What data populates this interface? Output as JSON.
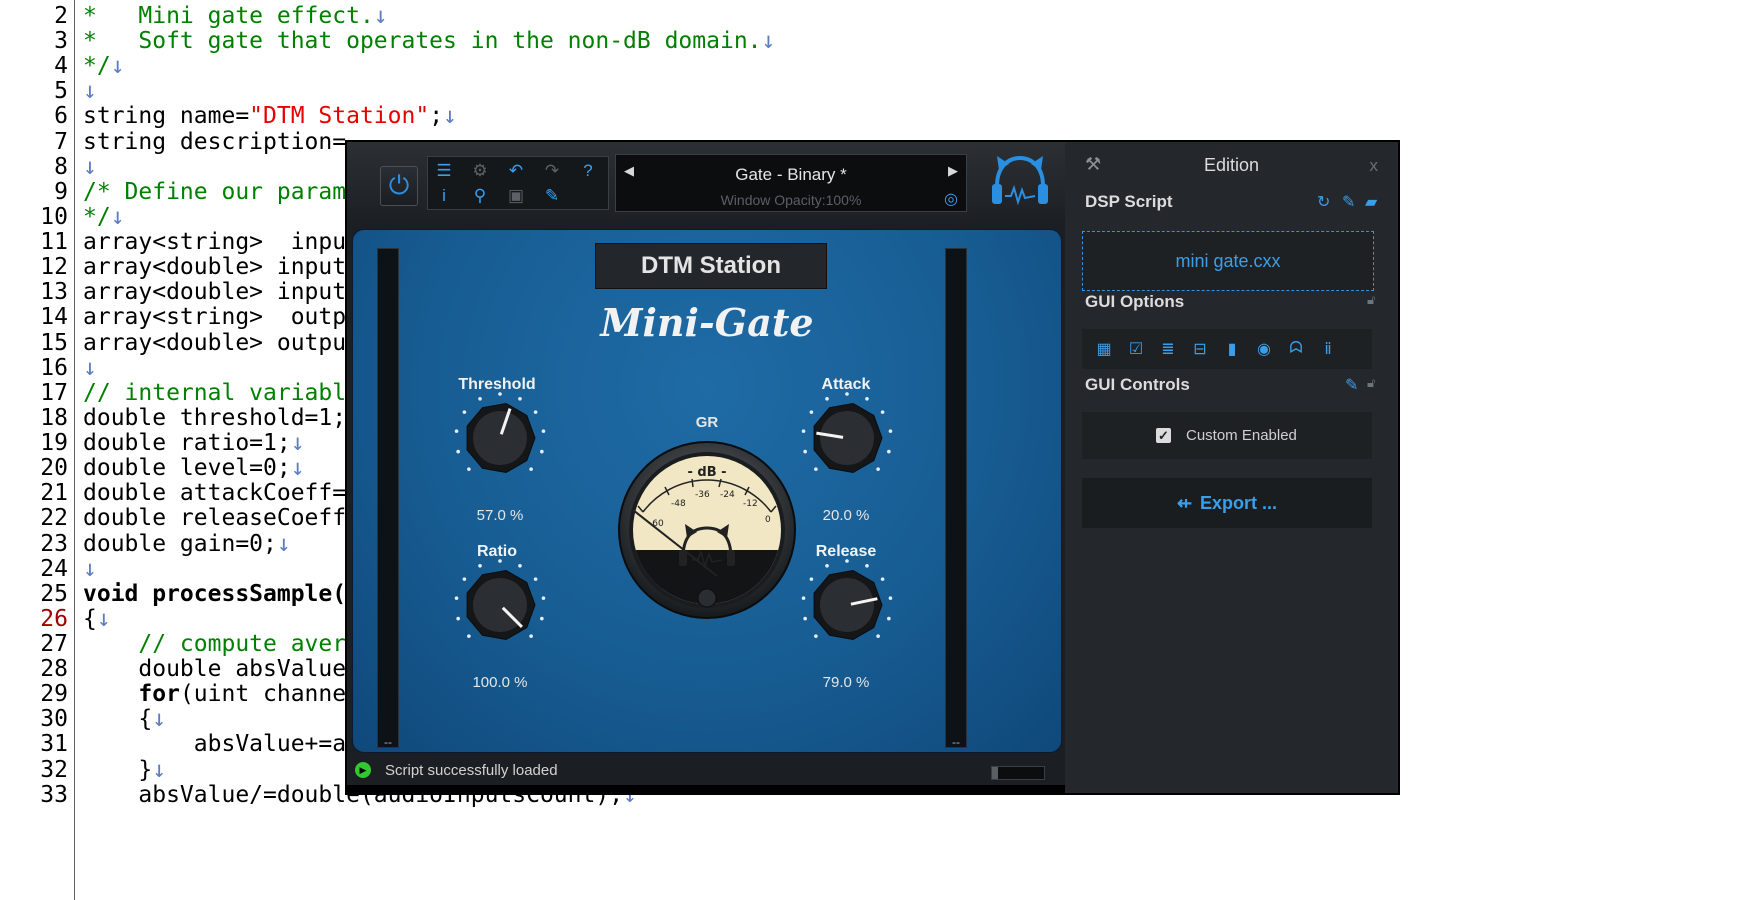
{
  "editor": {
    "current_line": "26",
    "lines": [
      {
        "num": "2",
        "parts": [
          {
            "t": "*   Mini gate effect.",
            "c": "cm"
          },
          {
            "t": "↓",
            "c": "ar"
          }
        ]
      },
      {
        "num": "3",
        "parts": [
          {
            "t": "*   Soft gate that operates in the non-dB domain.",
            "c": "cm"
          },
          {
            "t": "↓",
            "c": "ar"
          }
        ]
      },
      {
        "num": "4",
        "parts": [
          {
            "t": "*/",
            "c": "cm"
          },
          {
            "t": "↓",
            "c": "ar"
          }
        ]
      },
      {
        "num": "5",
        "parts": [
          {
            "t": "↓",
            "c": "ar"
          }
        ]
      },
      {
        "num": "6",
        "parts": [
          {
            "t": "string name=",
            "c": ""
          },
          {
            "t": "\"DTM Station\"",
            "c": "st"
          },
          {
            "t": ";",
            "c": ""
          },
          {
            "t": "↓",
            "c": "ar"
          }
        ]
      },
      {
        "num": "7",
        "parts": [
          {
            "t": "string description=",
            "c": ""
          }
        ]
      },
      {
        "num": "8",
        "parts": [
          {
            "t": "↓",
            "c": "ar"
          }
        ]
      },
      {
        "num": "9",
        "parts": [
          {
            "t": "/* Define our param",
            "c": "cm"
          }
        ]
      },
      {
        "num": "10",
        "parts": [
          {
            "t": "*/",
            "c": "cm"
          },
          {
            "t": "↓",
            "c": "ar"
          }
        ]
      },
      {
        "num": "11",
        "parts": [
          {
            "t": "array<string>  inpu",
            "c": ""
          }
        ]
      },
      {
        "num": "12",
        "parts": [
          {
            "t": "array<double> input",
            "c": ""
          }
        ]
      },
      {
        "num": "13",
        "parts": [
          {
            "t": "array<double> input",
            "c": ""
          }
        ]
      },
      {
        "num": "14",
        "parts": [
          {
            "t": "array<string>  outp",
            "c": ""
          }
        ]
      },
      {
        "num": "15",
        "parts": [
          {
            "t": "array<double> outpu",
            "c": ""
          }
        ]
      },
      {
        "num": "16",
        "parts": [
          {
            "t": "↓",
            "c": "ar"
          }
        ]
      },
      {
        "num": "17",
        "parts": [
          {
            "t": "// internal variabl",
            "c": "cm"
          }
        ]
      },
      {
        "num": "18",
        "parts": [
          {
            "t": "double threshold=1;",
            "c": ""
          }
        ]
      },
      {
        "num": "19",
        "parts": [
          {
            "t": "double ratio=1;",
            "c": ""
          },
          {
            "t": "↓",
            "c": "ar"
          }
        ]
      },
      {
        "num": "20",
        "parts": [
          {
            "t": "double level=0;",
            "c": ""
          },
          {
            "t": "↓",
            "c": "ar"
          }
        ]
      },
      {
        "num": "21",
        "parts": [
          {
            "t": "double attackCoeff=",
            "c": ""
          }
        ]
      },
      {
        "num": "22",
        "parts": [
          {
            "t": "double releaseCoeff",
            "c": ""
          }
        ]
      },
      {
        "num": "23",
        "parts": [
          {
            "t": "double gain=0;",
            "c": ""
          },
          {
            "t": "↓",
            "c": "ar"
          }
        ]
      },
      {
        "num": "24",
        "parts": [
          {
            "t": "↓",
            "c": "ar"
          }
        ]
      },
      {
        "num": "25",
        "parts": [
          {
            "t": "void processSample(",
            "c": "kw"
          }
        ]
      },
      {
        "num": "26",
        "parts": [
          {
            "t": "{",
            "c": ""
          },
          {
            "t": "↓",
            "c": "ar"
          }
        ]
      },
      {
        "num": "27",
        "parts": [
          {
            "t": "    // compute aver",
            "c": "cm"
          }
        ]
      },
      {
        "num": "28",
        "parts": [
          {
            "t": "    double absValue",
            "c": ""
          }
        ]
      },
      {
        "num": "29",
        "parts": [
          {
            "t": "    ",
            "c": ""
          },
          {
            "t": "for",
            "c": "kw"
          },
          {
            "t": "(uint channe",
            "c": ""
          }
        ]
      },
      {
        "num": "30",
        "parts": [
          {
            "t": "    {",
            "c": ""
          },
          {
            "t": "↓",
            "c": "ar"
          }
        ]
      },
      {
        "num": "31",
        "parts": [
          {
            "t": "        absValue+=abs(ioSample[channel]);",
            "c": ""
          },
          {
            "t": "↓",
            "c": "ar"
          }
        ]
      },
      {
        "num": "32",
        "parts": [
          {
            "t": "    }",
            "c": ""
          },
          {
            "t": "↓",
            "c": "ar"
          }
        ]
      },
      {
        "num": "33",
        "parts": [
          {
            "t": "    absValue/=double(audioInputsCount);",
            "c": ""
          },
          {
            "t": "↓",
            "c": "ar"
          }
        ]
      }
    ]
  },
  "plugin": {
    "toolbar_icons": [
      "list-icon",
      "gear-icon",
      "undo-icon",
      "redo-icon",
      "help-icon",
      "info-icon",
      "zoom-icon",
      "screenshot-icon",
      "edit-icon"
    ],
    "preset": {
      "name": "Gate - Binary *",
      "opacity": "Window Opacity:100%"
    },
    "panel_title": "DTM Station",
    "plugin_name": "Mini-Gate",
    "gr_label": "GR",
    "vu_scale": {
      "unit": "- dB -",
      "ticks": [
        "-48",
        "-36",
        "-24",
        "-12",
        "0"
      ],
      "first": "-60"
    },
    "rail_label": "--",
    "knobs": [
      {
        "id": "threshold",
        "label": "Threshold",
        "value": "57.0 %",
        "fraction": 0.57
      },
      {
        "id": "ratio",
        "label": "Ratio",
        "value": "100.0 %",
        "fraction": 1.0
      },
      {
        "id": "attack",
        "label": "Attack",
        "value": "20.0 %",
        "fraction": 0.2
      },
      {
        "id": "release",
        "label": "Release",
        "value": "79.0 %",
        "fraction": 0.79
      }
    ],
    "status": "Script successfully loaded",
    "cpu_fraction": 0.12
  },
  "side": {
    "title": "Edition",
    "close": "x",
    "dsp_label": "DSP Script",
    "script_file": "mini gate.cxx",
    "gui_options_label": "GUI Options",
    "gui_controls_label": "GUI Controls",
    "custom_enabled_label": "Custom Enabled",
    "export_label": "Export ..."
  },
  "colors": {
    "accent": "#3a9ee8",
    "face": "#175d93",
    "comment": "#008000",
    "string": "#e60000"
  }
}
